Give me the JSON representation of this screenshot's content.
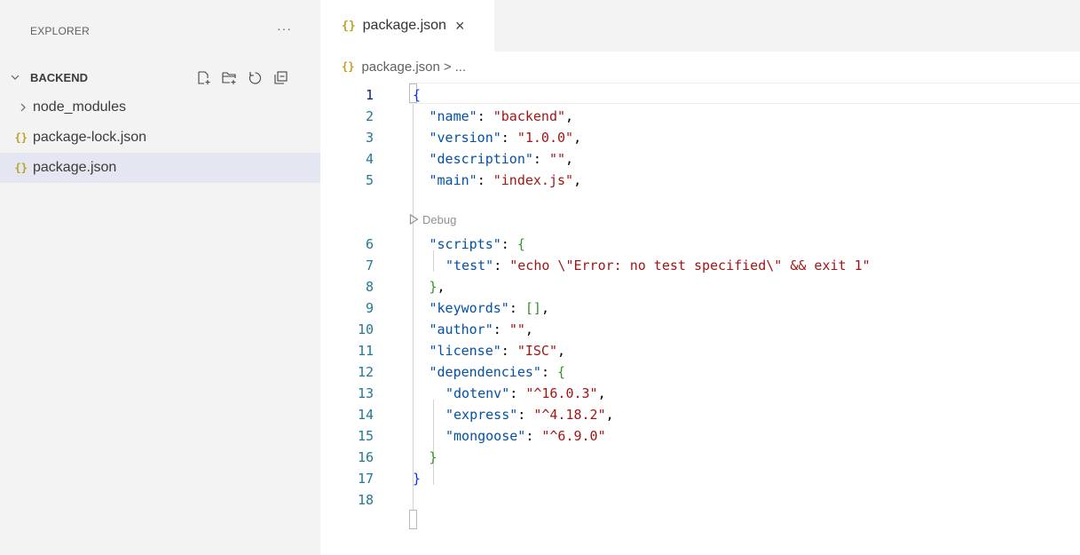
{
  "explorer": {
    "title": "EXPLORER",
    "more": "···",
    "section": "BACKEND",
    "actions": [
      "new-file-icon",
      "new-folder-icon",
      "refresh-icon",
      "collapse-all-icon"
    ],
    "items": [
      {
        "label": "node_modules",
        "kind": "folder"
      },
      {
        "label": "package-lock.json",
        "kind": "json"
      },
      {
        "label": "package.json",
        "kind": "json",
        "selected": true
      }
    ]
  },
  "tabs": [
    {
      "label": "package.json",
      "close": "×"
    }
  ],
  "breadcrumb": {
    "file": "package.json",
    "sep": ">",
    "rest": "..."
  },
  "codelens": {
    "label": "Debug"
  },
  "editor": {
    "line_numbers": [
      "1",
      "2",
      "3",
      "4",
      "5",
      "6",
      "7",
      "8",
      "9",
      "10",
      "11",
      "12",
      "13",
      "14",
      "15",
      "16",
      "17",
      "18"
    ],
    "lines": [
      {
        "open": "{"
      },
      {
        "key": "\"name\"",
        "value": "\"backend\"",
        "trail": ","
      },
      {
        "key": "\"version\"",
        "value": "\"1.0.0\"",
        "trail": ","
      },
      {
        "key": "\"description\"",
        "value": "\"\"",
        "trail": ","
      },
      {
        "key": "\"main\"",
        "value": "\"index.js\"",
        "trail": ","
      },
      {
        "key": "\"scripts\"",
        "bracket": "{"
      },
      {
        "key": "\"test\"",
        "value": "\"echo \\\"Error: no test specified\\\" && exit 1\""
      },
      {
        "close": "}",
        "trail": ","
      },
      {
        "key": "\"keywords\"",
        "bracket": "[]",
        "trail": ","
      },
      {
        "key": "\"author\"",
        "value": "\"\"",
        "trail": ","
      },
      {
        "key": "\"license\"",
        "value": "\"ISC\"",
        "trail": ","
      },
      {
        "key": "\"dependencies\"",
        "bracket": "{"
      },
      {
        "key": "\"dotenv\"",
        "value": "\"^16.0.3\"",
        "trail": ","
      },
      {
        "key": "\"express\"",
        "value": "\"^4.18.2\"",
        "trail": ","
      },
      {
        "key": "\"mongoose\"",
        "value": "\"^6.9.0\""
      },
      {
        "close": "}"
      },
      {
        "open": "}"
      },
      {}
    ]
  },
  "colors": {
    "key": "#0451a5",
    "string": "#a31515",
    "bracket_green": "#319331",
    "bracket_blue": "#0431fa",
    "line_number": "#237893",
    "json_icon": "#c09f22"
  }
}
